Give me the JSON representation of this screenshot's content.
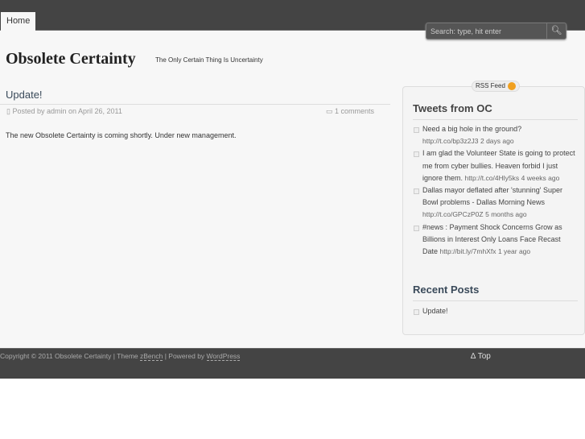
{
  "nav": {
    "home": "Home"
  },
  "search": {
    "placeholder": "Search: type, hit enter",
    "icon": "search-icon"
  },
  "site": {
    "title": "Obsolete Certainty",
    "tagline": "The Only Certain Thing Is Uncertainty"
  },
  "post": {
    "title": "Update!",
    "meta": "Posted by admin on April 26, 2011",
    "comments": "1 comments",
    "body": "The new Obsolete Certainty is coming shortly. Under new management."
  },
  "sidebar": {
    "rss": "RSS Feed",
    "tweets_title": "Tweets from OC",
    "tweets": [
      {
        "text": "Need a big hole in the ground?",
        "link": "http://t.co/bp3z2J3",
        "time": "2 days ago"
      },
      {
        "text": "I am glad the Volunteer State is going to protect me from cyber bullies. Heaven forbid I just ignore them.",
        "link": "http://t.co/4Hly5ks",
        "time": "4 weeks ago"
      },
      {
        "text": "Dallas mayor deflated after 'stunning' Super Bowl problems - Dallas Morning News",
        "link": "http://t.co/GPCzP0Z",
        "time": "5 months ago"
      },
      {
        "text": "#news : Payment Shock Concerns Grow as Billions in Interest Only Loans Face Recast Date",
        "link": "http://bit.ly/7mhXfx",
        "time": "1 year ago"
      }
    ],
    "recent_title": "Recent Posts",
    "recent": [
      "Update!"
    ]
  },
  "footer": {
    "copyright": "Copyright © 2011 Obsolete Certainty  | Theme ",
    "theme": "zBench",
    "powered": "  | Powered by ",
    "wp": "WordPress",
    "top": "∆ Top"
  }
}
